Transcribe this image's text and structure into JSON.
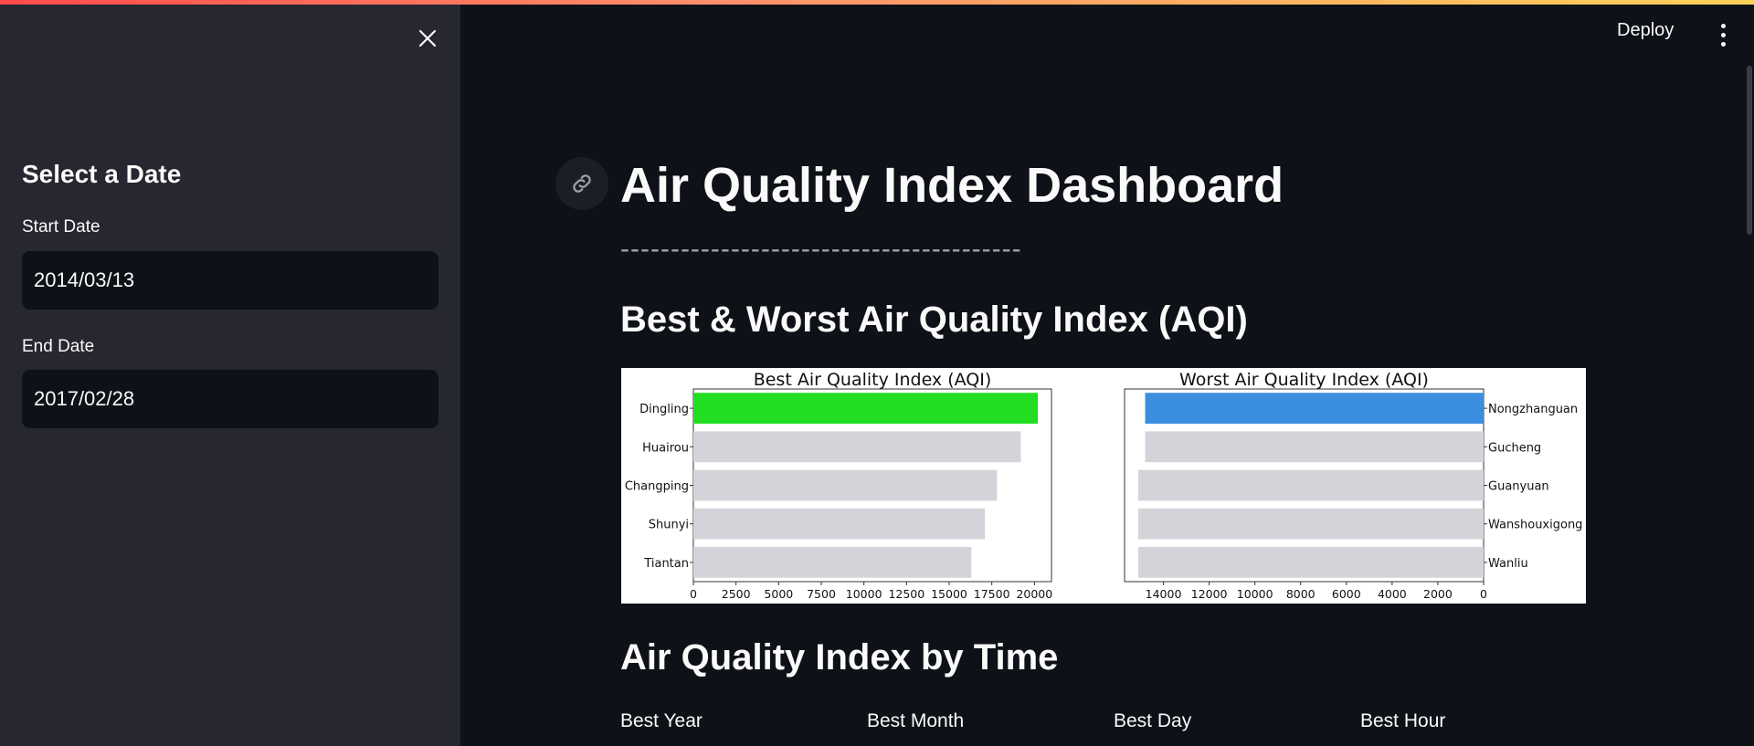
{
  "sidebar": {
    "heading": "Select a Date",
    "start_label": "Start Date",
    "start_value": "2014/03/13",
    "end_label": "End Date",
    "end_value": "2017/02/28"
  },
  "header": {
    "deploy_label": "Deploy"
  },
  "main": {
    "title": "Air Quality Index Dashboard",
    "divider": "----------------------------------------",
    "section1": "Best & Worst Air Quality Index (AQI)",
    "section2": "Air Quality Index by Time",
    "metrics": [
      "Best Year",
      "Best Month",
      "Best Day",
      "Best Hour"
    ]
  },
  "colors": {
    "best_highlight": "#22dd22",
    "worst_highlight": "#3b8de0",
    "other_bar": "#d3d3d9"
  },
  "chart_data": [
    {
      "type": "bar",
      "orientation": "horizontal",
      "title": "Best Air Quality Index (AQI)",
      "categories": [
        "Dingling",
        "Huairou",
        "Changping",
        "Shunyi",
        "Tiantan"
      ],
      "values": [
        20200,
        19200,
        17800,
        17100,
        16300
      ],
      "xlim": [
        0,
        21000
      ],
      "ticks": [
        0,
        2500,
        5000,
        7500,
        10000,
        12500,
        15000,
        17500,
        20000
      ]
    },
    {
      "type": "bar",
      "orientation": "horizontal",
      "inverted_x": true,
      "title": "Worst Air Quality Index (AQI)",
      "categories": [
        "Nongzhanguan",
        "Gucheng",
        "Guanyuan",
        "Wanshouxigong",
        "Wanliu"
      ],
      "values": [
        14800,
        14800,
        15100,
        15100,
        15100
      ],
      "xlim": [
        0,
        15700
      ],
      "ticks": [
        0,
        2000,
        4000,
        6000,
        8000,
        10000,
        12000,
        14000
      ]
    }
  ]
}
